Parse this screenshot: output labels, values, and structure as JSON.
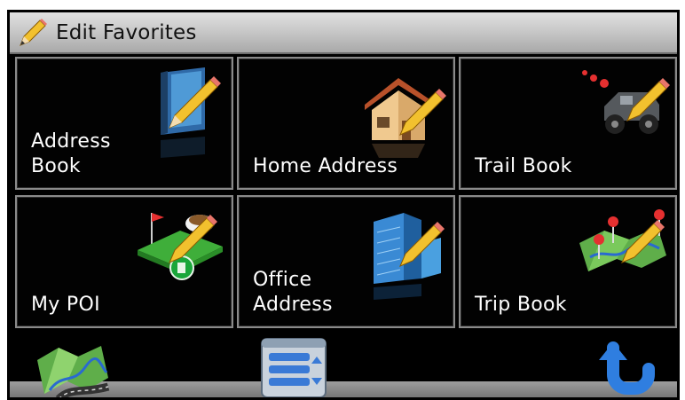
{
  "header": {
    "title": "Edit Favorites",
    "icon": "pencil-icon"
  },
  "tiles": [
    {
      "lines": [
        "Address",
        "Book"
      ],
      "icon": "address-book-icon"
    },
    {
      "lines": [
        "Home Address"
      ],
      "icon": "home-icon"
    },
    {
      "lines": [
        "Trail Book"
      ],
      "icon": "jeep-trail-icon"
    },
    {
      "lines": [
        "My POI"
      ],
      "icon": "poi-icon"
    },
    {
      "lines": [
        "Office",
        "Address"
      ],
      "icon": "office-building-icon"
    },
    {
      "lines": [
        "Trip Book"
      ],
      "icon": "trip-map-icon"
    }
  ],
  "toolbar": {
    "map_icon": "map-icon",
    "list_icon": "list-menu-icon",
    "back_icon": "back-arrow-icon"
  },
  "colors": {
    "background": "#000000",
    "titlebar": "#c9c9c9",
    "tile_border": "#8a8a8a",
    "text": "#ffffff",
    "accent_blue": "#2f7ee0"
  }
}
